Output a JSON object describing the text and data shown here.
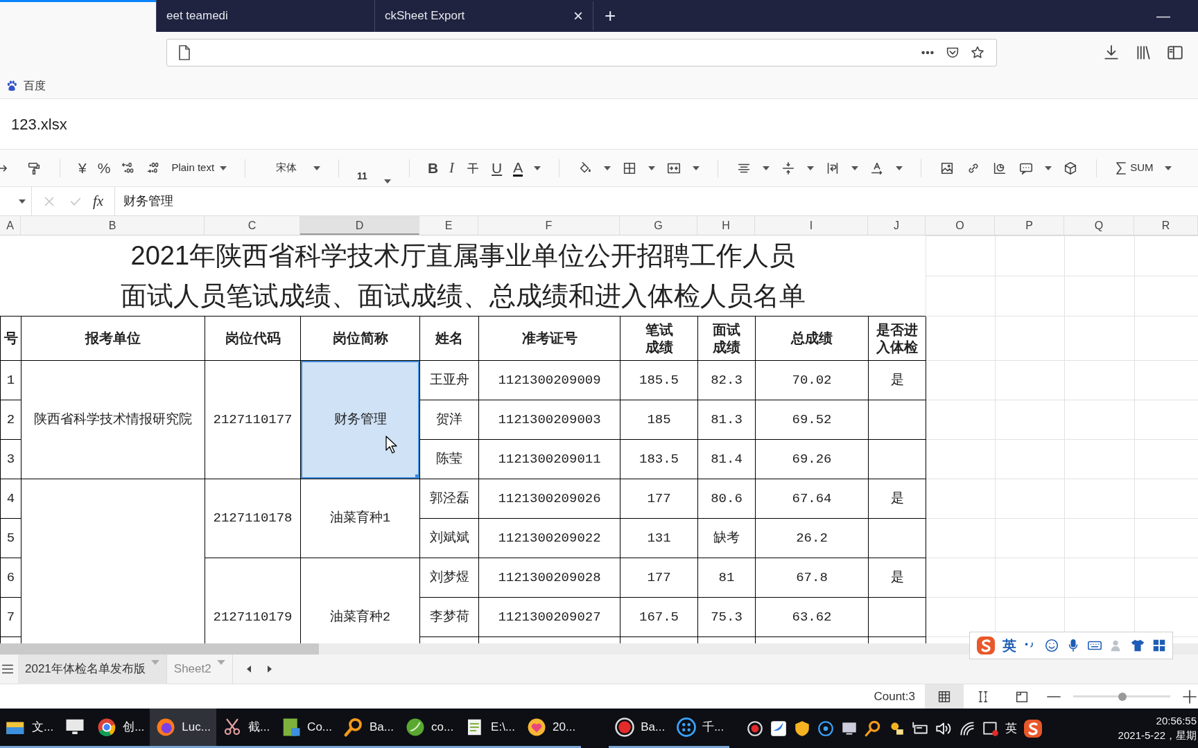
{
  "browser": {
    "tabs": [
      {
        "selected": true
      },
      {
        "label": "eet teamedi",
        "selected": false
      },
      {
        "label": "ckSheet Export",
        "selected": false,
        "close": "×"
      }
    ],
    "new_tab": "+",
    "minimize": "—"
  },
  "bookmarks": [
    {
      "label": "百度"
    }
  ],
  "file_name": "123.xlsx",
  "toolbar": {
    "currency": "¥",
    "percent": "%",
    "number_format": "Plain text",
    "font": "宋体",
    "font_size": "11",
    "bold": "B",
    "italic": "I",
    "underline": "U",
    "font_color": "A",
    "sum": "SUM"
  },
  "formula_bar": {
    "fx": "fx",
    "value": "财务管理"
  },
  "columns": [
    {
      "label": "A",
      "selected": false
    },
    {
      "label": "B",
      "selected": false
    },
    {
      "label": "C",
      "selected": false
    },
    {
      "label": "D",
      "selected": true
    },
    {
      "label": "E",
      "selected": false
    },
    {
      "label": "F",
      "selected": false
    },
    {
      "label": "G",
      "selected": false
    },
    {
      "label": "H",
      "selected": false
    },
    {
      "label": "I",
      "selected": false
    },
    {
      "label": "J",
      "selected": false
    },
    {
      "label": "O",
      "selected": false
    },
    {
      "label": "P",
      "selected": false
    },
    {
      "label": "Q",
      "selected": false
    },
    {
      "label": "R",
      "selected": false
    }
  ],
  "sheet": {
    "title_lines": [
      "2021年陕西省科学技术厅直属事业单位公开招聘工作人员",
      "面试人员笔试成绩、面试成绩、总成绩和进入体检人员名单"
    ],
    "headers": [
      "号",
      "报考单位",
      "岗位代码",
      "岗位简称",
      "姓名",
      "准考证号",
      "笔试成绩",
      "面试成绩",
      "总成绩",
      "是否进入体检"
    ],
    "units": [
      {
        "unit": "陕西省科学技术情报研究院",
        "posts": [
          {
            "code": "2127110177",
            "name": "财务管理",
            "selected": true,
            "people": [
              {
                "no": "1",
                "name": "王亚舟",
                "exam_id": "1121300209009",
                "written": "185.5",
                "interview": "82.3",
                "total": "70.02",
                "medical": "是"
              },
              {
                "no": "2",
                "name": "贺洋",
                "exam_id": "1121300209003",
                "written": "185",
                "interview": "81.3",
                "total": "69.52"
              },
              {
                "no": "3",
                "name": "陈莹",
                "exam_id": "1121300209011",
                "written": "183.5",
                "interview": "81.4",
                "total": "69.26"
              }
            ]
          }
        ]
      },
      {
        "posts": [
          {
            "code": "2127110178",
            "name": "油菜育种1",
            "selected": false,
            "people": [
              {
                "no": "4",
                "name": "郭泾磊",
                "exam_id": "1121300209026",
                "written": "177",
                "interview": "80.6",
                "total": "67.64",
                "medical": "是"
              },
              {
                "no": "5",
                "name": "刘斌斌",
                "exam_id": "1121300209022",
                "written": "131",
                "interview": "缺考",
                "total": "26.2"
              }
            ]
          },
          {
            "code": "2127110179",
            "name": "油菜育种2",
            "selected": false,
            "people": [
              {
                "no": "6",
                "name": "刘梦煜",
                "exam_id": "1121300209028",
                "written": "177",
                "interview": "81",
                "total": "67.8",
                "medical": "是"
              },
              {
                "no": "7",
                "name": "李梦荷",
                "exam_id": "1121300209027",
                "written": "167.5",
                "interview": "75.3",
                "total": "63.62"
              }
            ]
          }
        ]
      }
    ]
  },
  "sheet_tabs": [
    {
      "label": "2021年体检名单发布版",
      "selected": true
    },
    {
      "label": "Sheet2",
      "selected": false
    }
  ],
  "ime_bar": {
    "mode": "英"
  },
  "status_bar": {
    "count": "Count:3",
    "views": [
      {
        "selected": true
      },
      {
        "selected": false
      },
      {
        "selected": false
      }
    ],
    "zoom": {
      "level": 0.51
    }
  },
  "taskbar": {
    "items": [
      {
        "label": "文...",
        "selected": false
      },
      {
        "selected": false
      },
      {
        "label": "创...",
        "selected": false
      },
      {
        "label": "Luc...",
        "selected": true
      },
      {
        "label": "截...",
        "selected": false
      },
      {
        "label": "Co...",
        "selected": false
      },
      {
        "label": "Ba...",
        "selected": false
      },
      {
        "label": "co...",
        "selected": false
      },
      {
        "label": "E:\\...",
        "selected": false
      },
      {
        "label": "20...",
        "selected": false
      },
      {
        "label": "Ba...",
        "selected": false
      },
      {
        "label": "千...",
        "selected": false
      }
    ],
    "tray_ime": "英",
    "time": "20:56:55",
    "date": "2021-5-22，星期"
  }
}
